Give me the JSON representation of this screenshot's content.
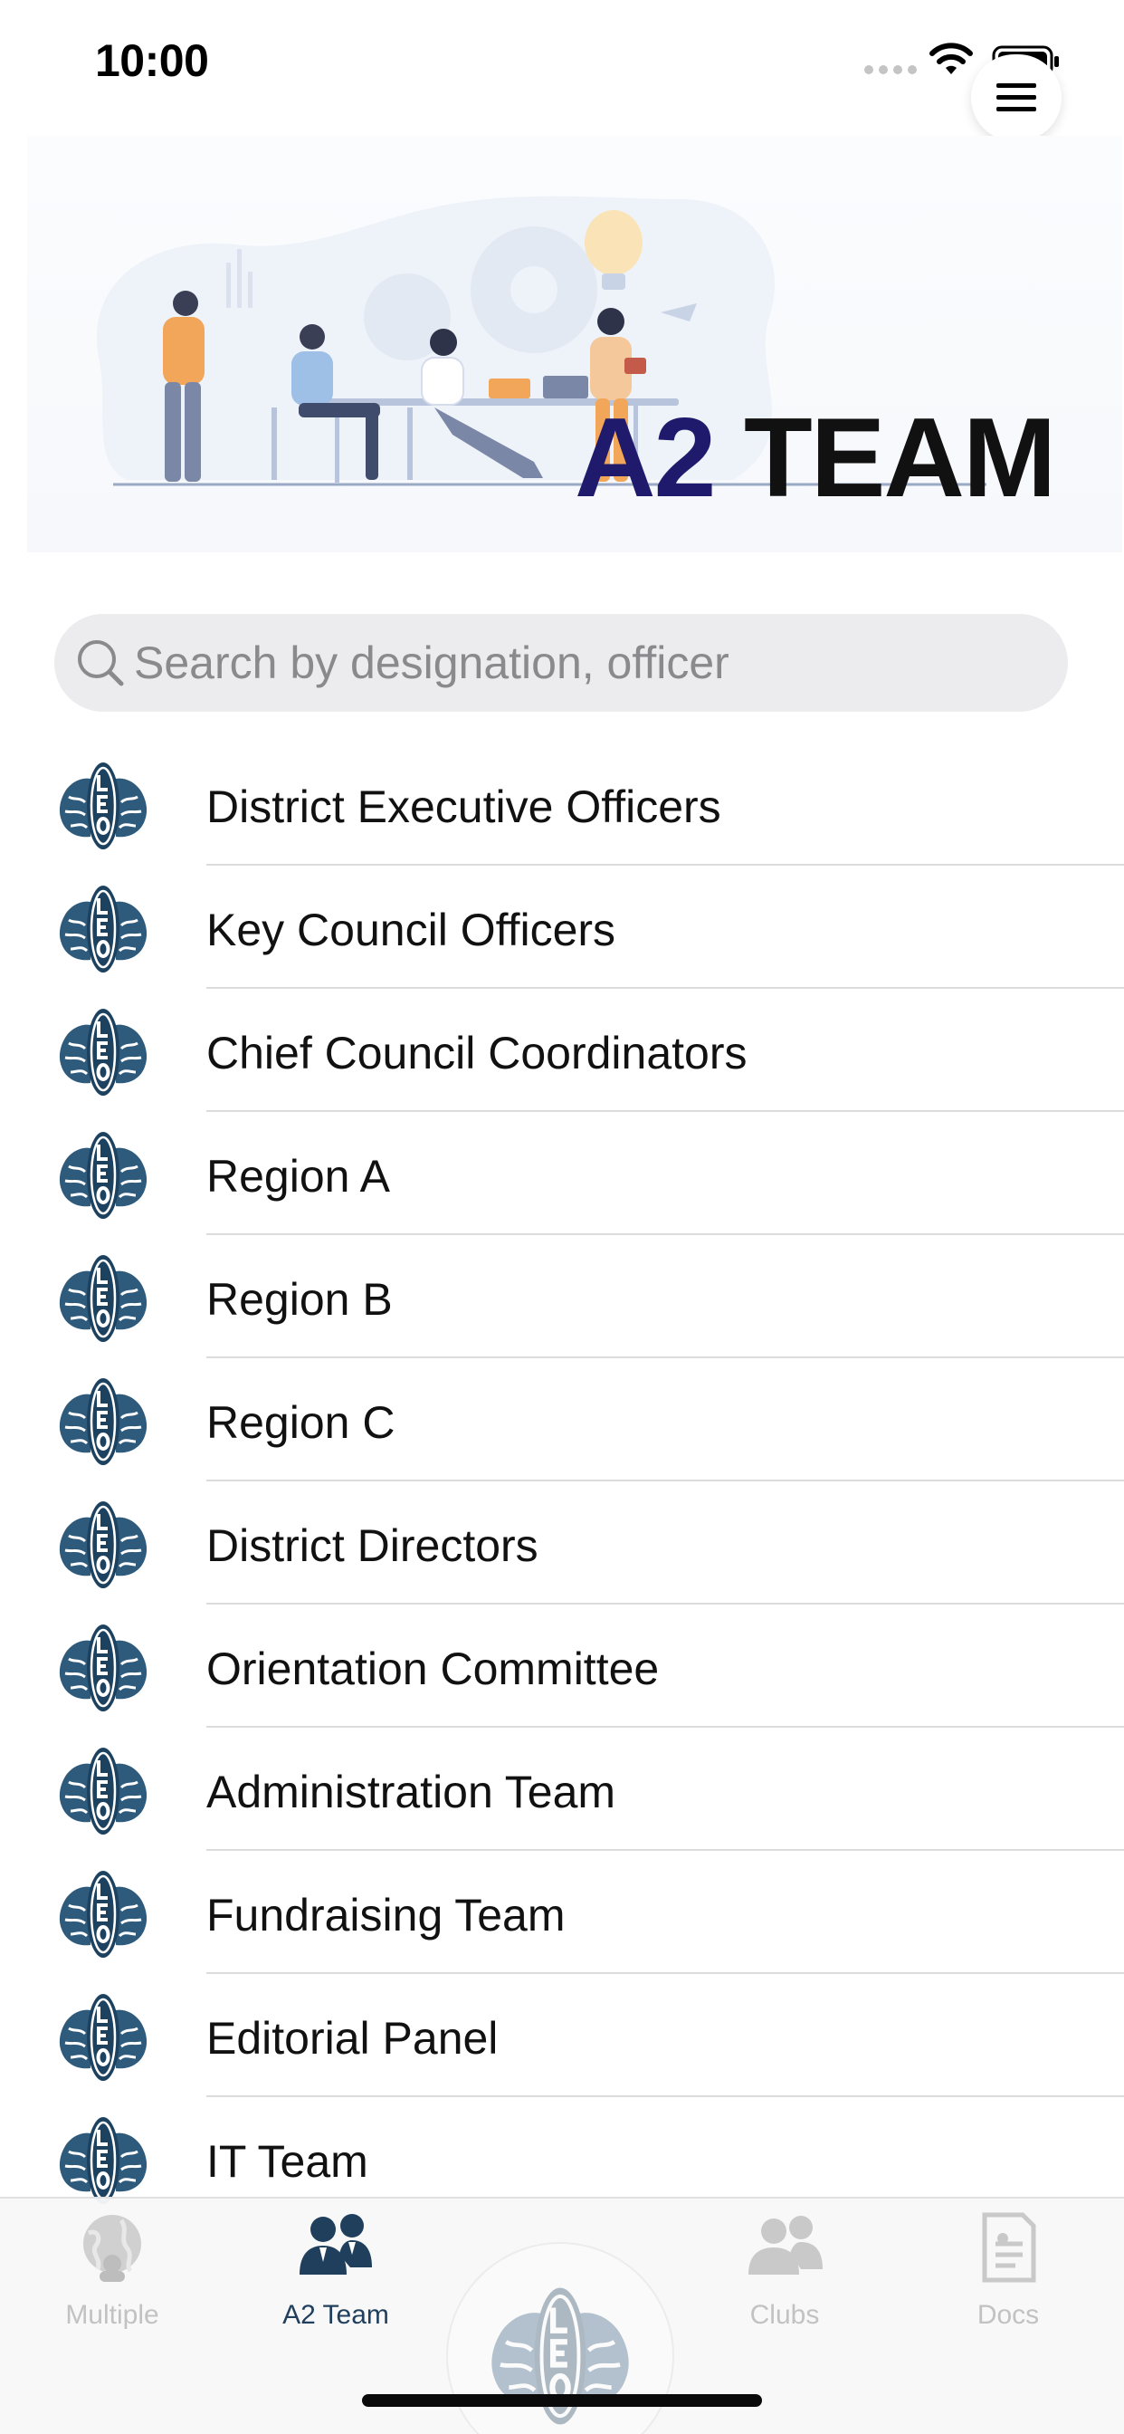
{
  "status_bar": {
    "time": "10:00"
  },
  "banner": {
    "title_accent": "A2",
    "title_rest": "TEAM"
  },
  "search": {
    "placeholder": "Search by designation, officer"
  },
  "list": {
    "items": [
      {
        "label": "District Executive Officers"
      },
      {
        "label": "Key Council Officers"
      },
      {
        "label": "Chief Council Coordinators"
      },
      {
        "label": "Region A"
      },
      {
        "label": "Region B"
      },
      {
        "label": "Region C"
      },
      {
        "label": "District Directors"
      },
      {
        "label": "Orientation Committee"
      },
      {
        "label": "Administration Team"
      },
      {
        "label": "Fundraising Team"
      },
      {
        "label": "Editorial Panel"
      },
      {
        "label": "IT Team"
      }
    ]
  },
  "tab_bar": {
    "tabs": [
      {
        "label": "Multiple",
        "icon": "globe-icon",
        "active": false
      },
      {
        "label": "A2 Team",
        "icon": "team-icon",
        "active": true
      },
      {
        "label": "",
        "icon": "leo-logo-icon",
        "active": false
      },
      {
        "label": "Clubs",
        "icon": "clubs-icon",
        "active": false
      },
      {
        "label": "Docs",
        "icon": "docs-icon",
        "active": false
      }
    ]
  },
  "colors": {
    "accent": "#1f3f5c",
    "title_accent": "#1f1a6b",
    "inactive": "#c2c2c2"
  }
}
